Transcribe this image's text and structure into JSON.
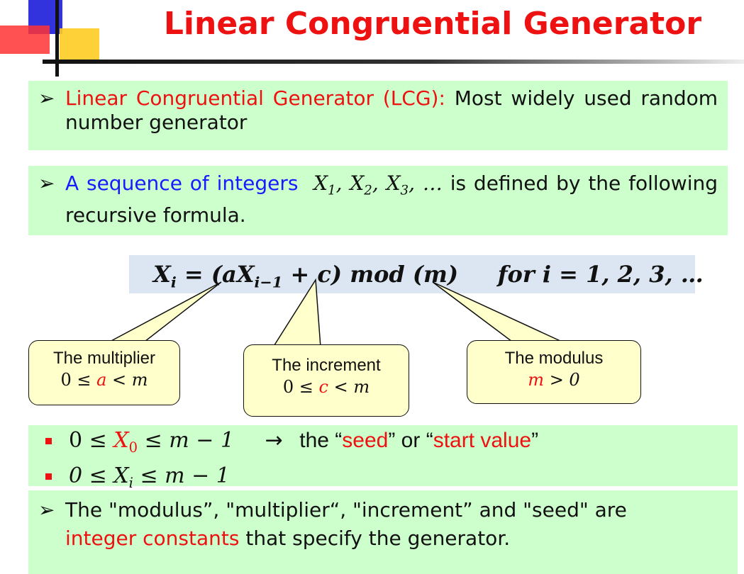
{
  "title": "Linear Congruential Generator",
  "box1": {
    "lead": "Linear Congruential Generator (LCG):",
    "rest": "Most widely used random number generator"
  },
  "box2": {
    "lead": "A sequence of integers",
    "mid": "is defined by the following recursive formula."
  },
  "formula": {
    "lhs": "X",
    "sub": "i",
    "eq": " = (aX",
    "sub2": "i−1",
    "rest": " + c) mod (m)",
    "gap": "     ",
    "tail": "for i = 1, 2, 3, …"
  },
  "callouts": {
    "multiplier": {
      "label": "The multiplier",
      "cond_pre": "0 ≤ ",
      "var": "a",
      "cond_post": " < m"
    },
    "increment": {
      "label": "The increment",
      "cond_pre": "0 ≤ ",
      "var": "c",
      "cond_post": " < m"
    },
    "modulus": {
      "label": "The modulus",
      "var": "m",
      "cond_post": " > 0"
    }
  },
  "bullets": {
    "b1_pre": "0 ≤ ",
    "b1_var": "X",
    "b1_sub": "0",
    "b1_post": " ≤ m − 1",
    "arrow": "→",
    "the": "the “",
    "seed": "seed",
    "or": "” or “",
    "start": "start value",
    "close": "”",
    "b2_pre": "0 ≤ X",
    "b2_sub": "i",
    "b2_post": " ≤ m − 1"
  },
  "box3": {
    "line1": "The \"modulus”, \"multiplier“, \"increment” and \"seed\" are",
    "red": "integer constants",
    "rest": " that specify the generator."
  },
  "colors": {
    "red": "#ee1111",
    "blue": "#1a1aff",
    "green_box": "#ccffcc",
    "formula_bg": "#dce6f2",
    "callout_bg": "#ffffcc"
  }
}
